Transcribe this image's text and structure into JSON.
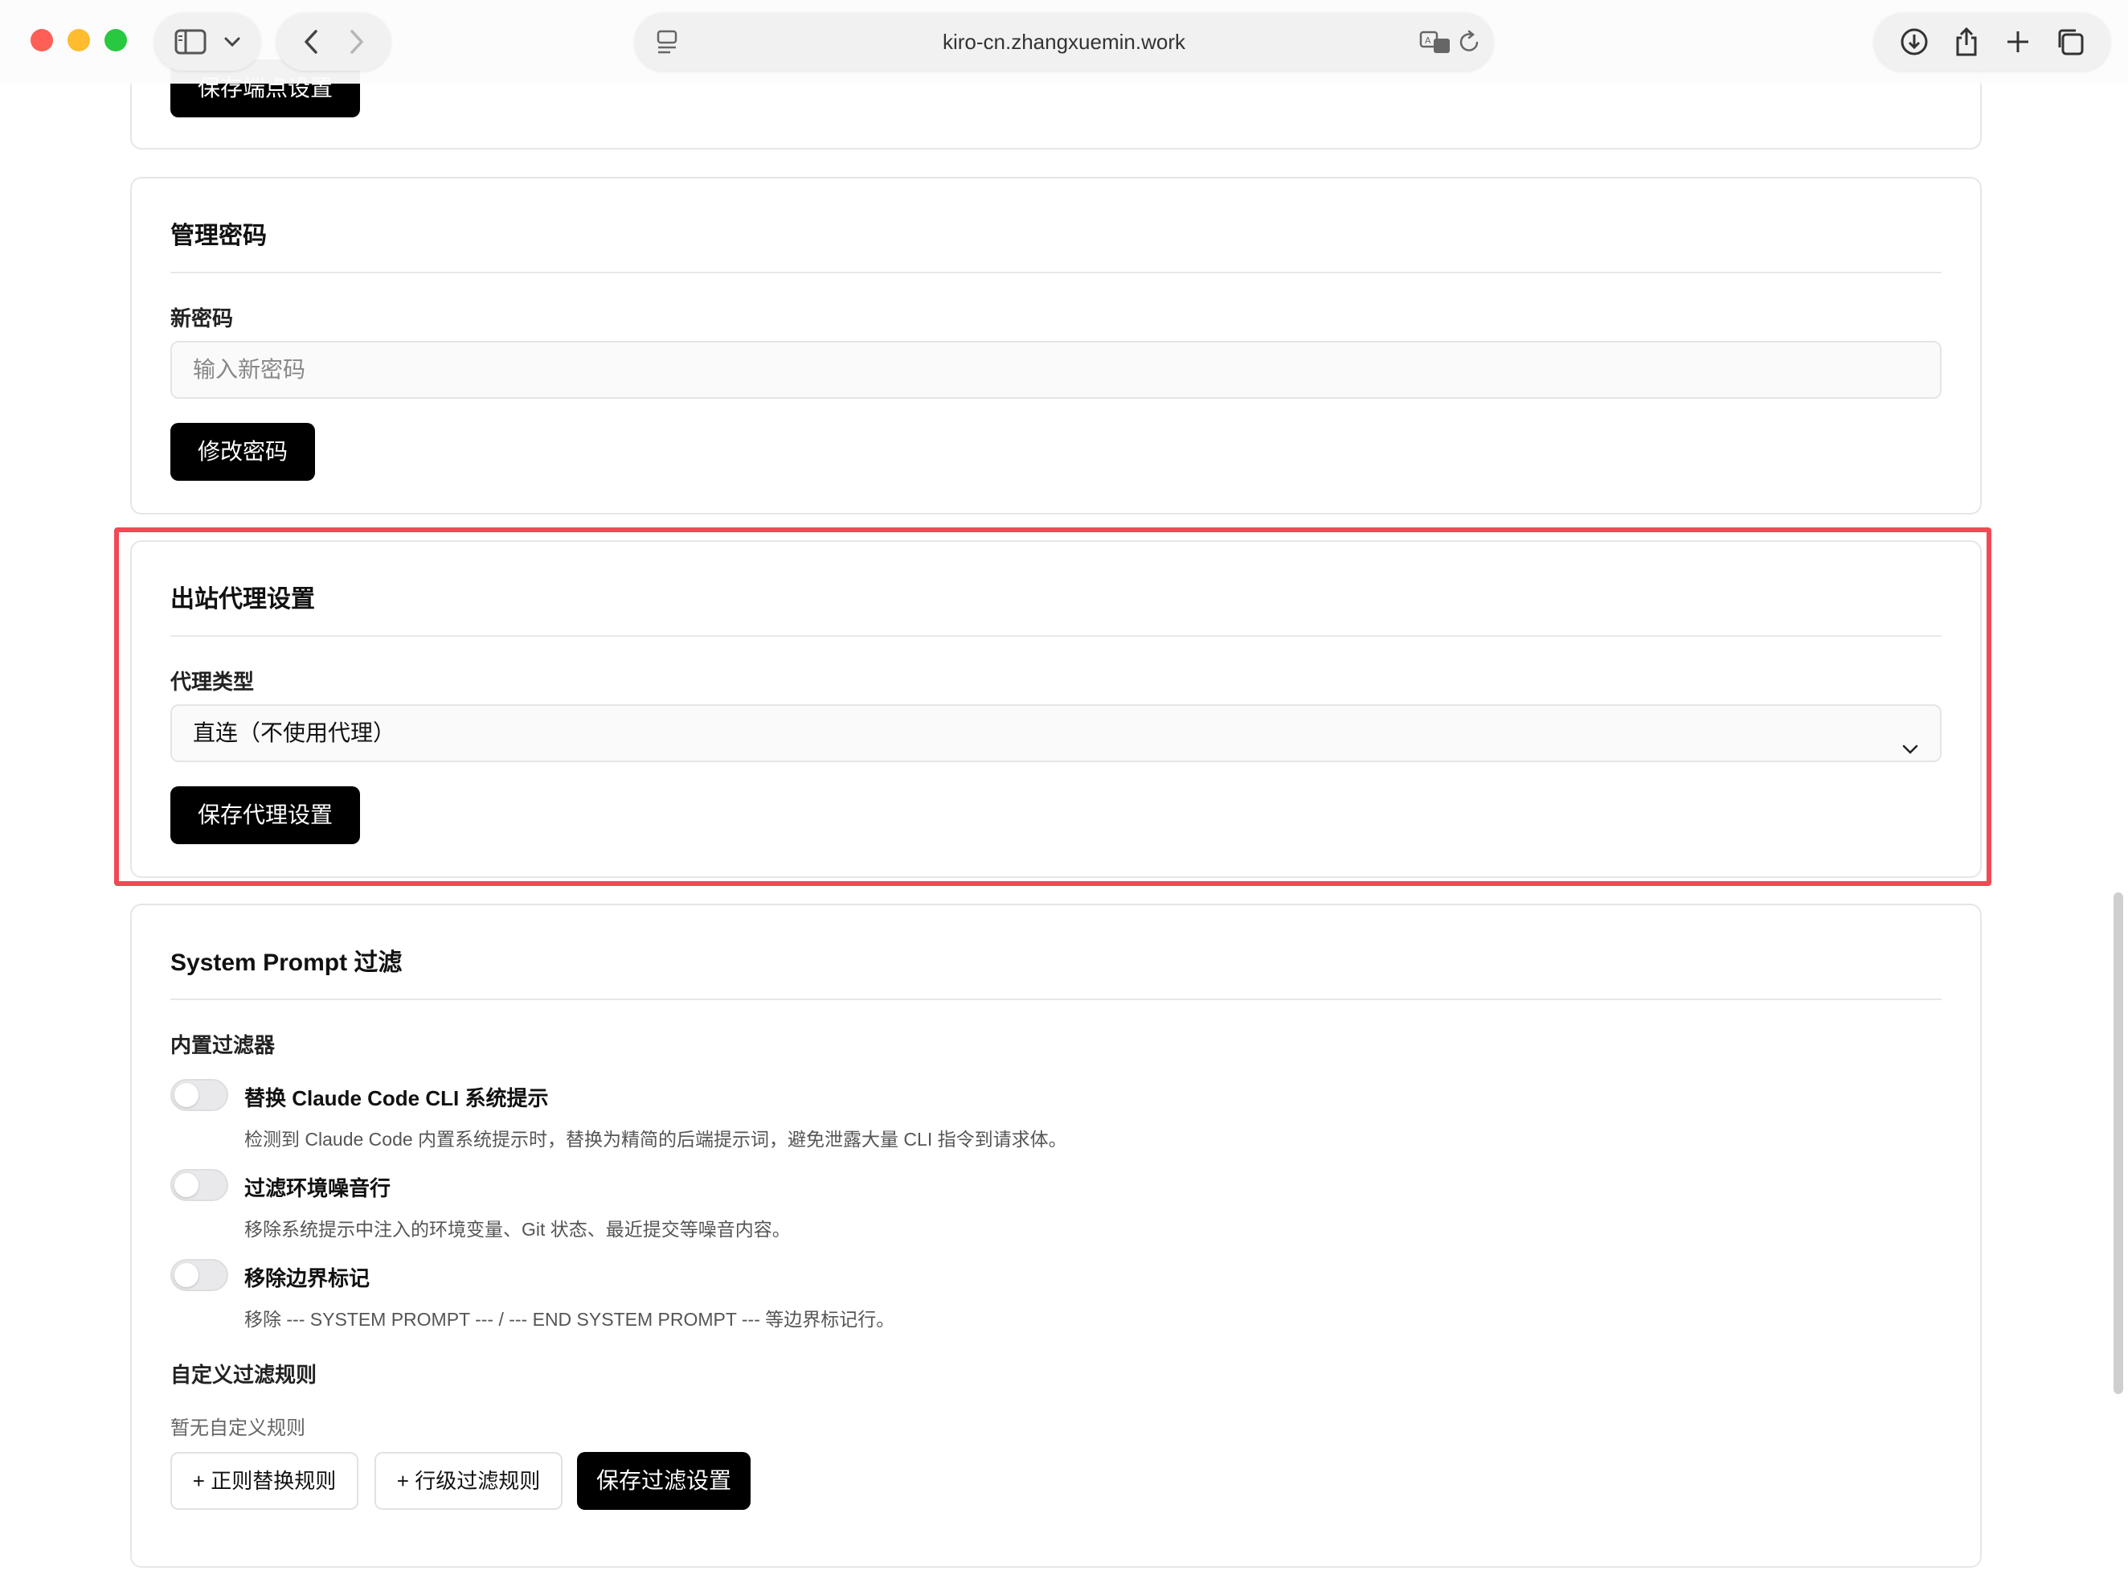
{
  "browser": {
    "url": "kiro-cn.zhangxuemin.work"
  },
  "endpoint_card": {
    "save_label": "保存端点设置"
  },
  "password_card": {
    "title": "管理密码",
    "field_label": "新密码",
    "placeholder": "输入新密码",
    "button_label": "修改密码"
  },
  "proxy_card": {
    "title": "出站代理设置",
    "field_label": "代理类型",
    "selected_option": "直连（不使用代理）",
    "button_label": "保存代理设置"
  },
  "filter_card": {
    "title": "System Prompt 过滤",
    "builtin_label": "内置过滤器",
    "filters": [
      {
        "title": "替换 Claude Code CLI 系统提示",
        "desc": "检测到 Claude Code 内置系统提示时，替换为精简的后端提示词，避免泄露大量 CLI 指令到请求体。",
        "enabled": false
      },
      {
        "title": "过滤环境噪音行",
        "desc": "移除系统提示中注入的环境变量、Git 状态、最近提交等噪音内容。",
        "enabled": false
      },
      {
        "title": "移除边界标记",
        "desc": "移除 --- SYSTEM PROMPT --- / --- END SYSTEM PROMPT --- 等边界标记行。",
        "enabled": false
      }
    ],
    "custom_label": "自定义过滤规则",
    "empty_text": "暂无自定义规则",
    "add_regex_label": "+ 正则替换规则",
    "add_line_label": "+ 行级过滤规则",
    "save_label": "保存过滤设置"
  }
}
